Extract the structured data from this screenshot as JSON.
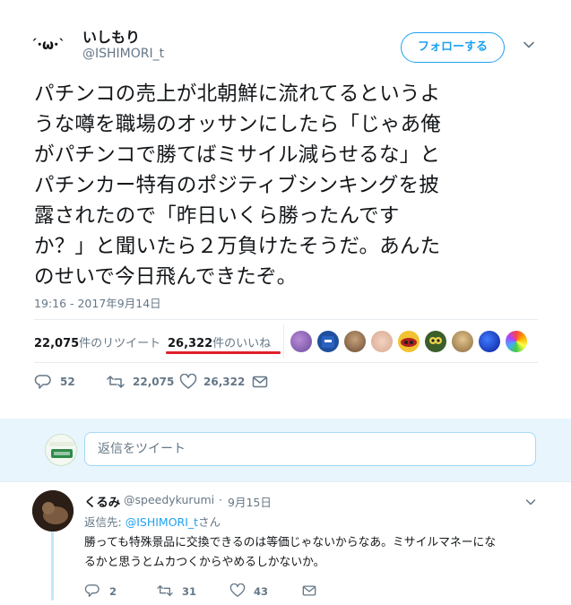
{
  "tweet": {
    "author": {
      "avatar_text": "´･ω･`",
      "display_name": "いしもり",
      "handle": "@ISHIMORI_t"
    },
    "follow_label": "フォローする",
    "text": "パチンコの売上が北朝鮮に流れてるというよ\nうな噂を職場のオッサンにしたら「じゃあ俺\nがパチンコで勝てばミサイル減らせるな」と\nパチンカー特有のポジティブシンキングを披\n露されたので「昨日いくら勝ったんです\nか？」と聞いたら２万負けたそうだ。あんた\nのせいで今日飛んできたぞ。",
    "timestamp": "19:16 - 2017年9月14日",
    "stats": {
      "retweets_count": "22,075",
      "retweets_label": "件のリツイート",
      "likes_count": "26,322",
      "likes_label": "件のいいね"
    },
    "actions": {
      "reply_count": "52",
      "retweet_count": "22,075",
      "like_count": "26,322"
    },
    "accent_color": "#1da1f2",
    "highlight_color": "#e0202a"
  },
  "reply_composer": {
    "placeholder": "返信をツイート"
  },
  "replies": [
    {
      "display_name": "くるみ",
      "handle": "@speedykurumi",
      "separator": "·",
      "date": "9月15日",
      "reply_to_label": "返信先:",
      "reply_to_handle": "@ISHIMORI_t",
      "reply_to_suffix": "さん",
      "text": "勝っても特殊景品に交換できるのは等価じゃないからなあ。ミサイルマネーにな\nるかと思うとムカつくからやめるしかないか。",
      "reply_count": "2",
      "retweet_count": "31",
      "like_count": "43"
    }
  ]
}
